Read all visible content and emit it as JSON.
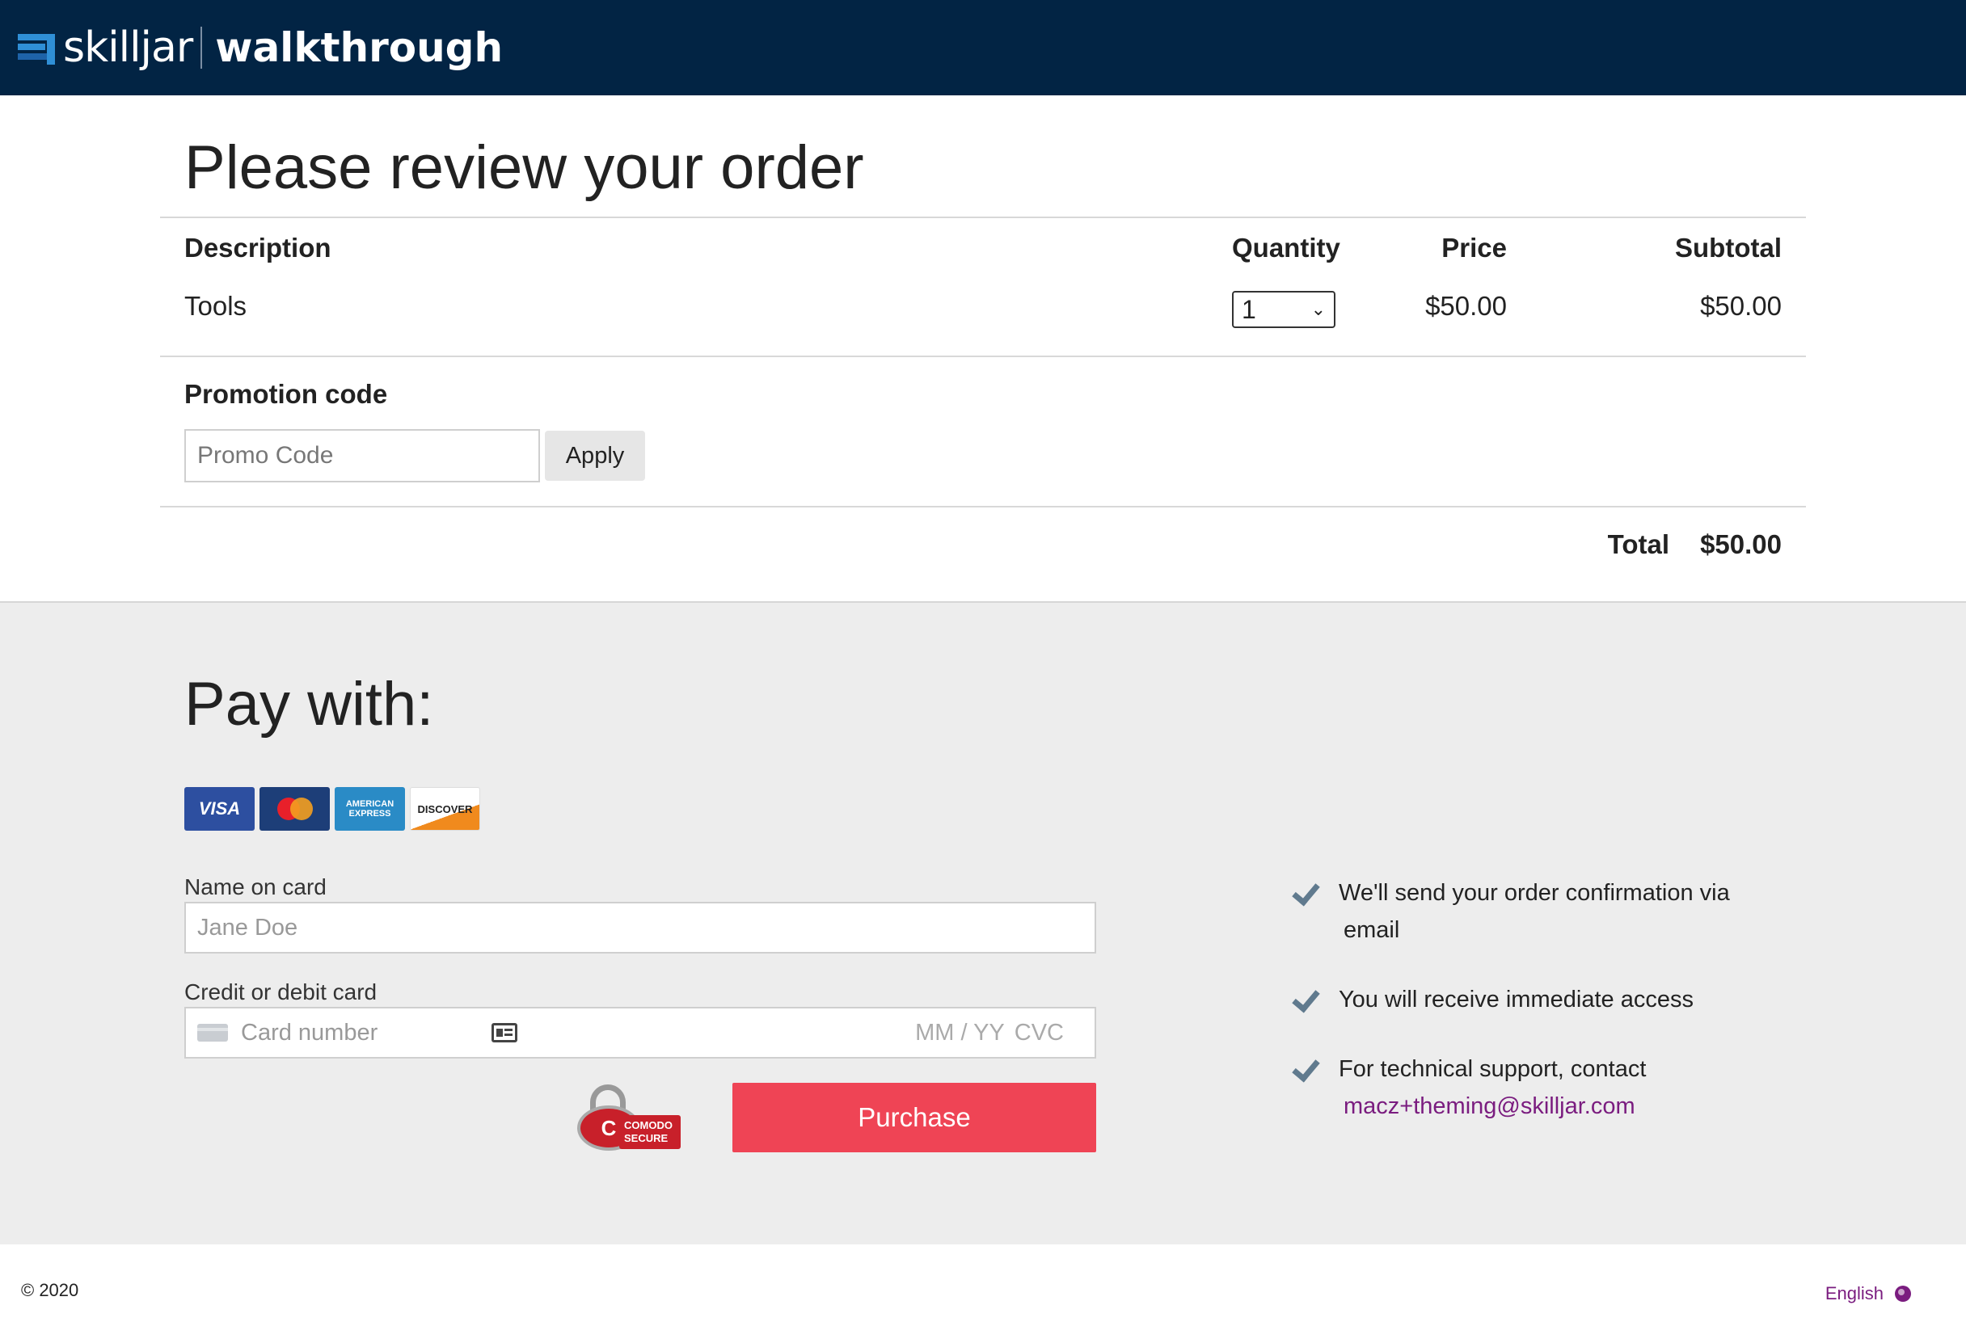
{
  "header": {
    "brand": "skilljar",
    "subtitle": "walkthrough"
  },
  "review": {
    "title": "Please review your order",
    "columns": {
      "description": "Description",
      "quantity": "Quantity",
      "price": "Price",
      "subtotal": "Subtotal"
    },
    "items": [
      {
        "description": "Tools",
        "quantity": "1",
        "price": "$50.00",
        "subtotal": "$50.00"
      }
    ],
    "promo": {
      "label": "Promotion code",
      "placeholder": "Promo Code",
      "apply_label": "Apply"
    },
    "total": {
      "label": "Total",
      "value": "$50.00"
    }
  },
  "pay": {
    "title": "Pay with:",
    "cards": [
      {
        "name": "visa-card-icon",
        "label": "VISA"
      },
      {
        "name": "mastercard-card-icon",
        "label": "MasterCard"
      },
      {
        "name": "amex-card-icon",
        "label": "AMERICAN EXPRESS"
      },
      {
        "name": "discover-card-icon",
        "label": "DISCOVER"
      }
    ],
    "name_label": "Name on card",
    "name_placeholder": "Jane Doe",
    "card_label": "Credit or debit card",
    "card_placeholder": "Card number",
    "expiry_placeholder": "MM / YY",
    "cvc_placeholder": "CVC",
    "secure_badge": {
      "letter": "C",
      "text": "COMODO SECURE"
    },
    "purchase_label": "Purchase",
    "benefits": {
      "confirmation_line1": "We'll send your order confirmation via",
      "confirmation_line2": "email",
      "access": "You will receive immediate access",
      "support": "For technical support, contact",
      "support_email": "macz+theming@skilljar.com"
    }
  },
  "footer": {
    "copyright": "© 2020",
    "language": "English"
  },
  "colors": {
    "header_bg": "#022444",
    "purchase": "#ef4455",
    "link": "#7a1c7f",
    "pay_bg": "#ededed"
  }
}
